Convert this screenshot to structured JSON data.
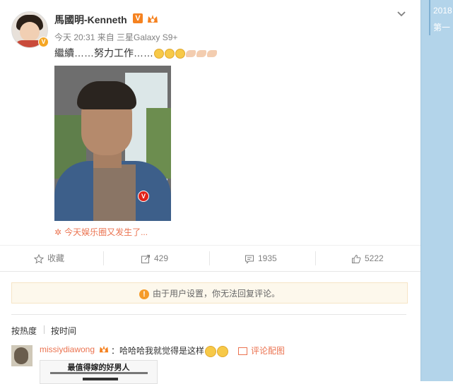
{
  "post": {
    "username": "馬國明-Kenneth",
    "verified_label": "V",
    "meta": "今天 20:31 来自 三星Galaxy S9+",
    "text": "繼續……努力工作……",
    "topic": "今天娱乐圈又发生了..."
  },
  "actions": {
    "favorite": "收藏",
    "repost_count": "429",
    "comment_count": "1935",
    "like_count": "5222"
  },
  "notice": "由于用户设置，你无法回复评论。",
  "sort": {
    "hot": "按热度",
    "time": "按时间"
  },
  "comment": {
    "user": "missiydiawong",
    "text": "：哈哈哈我就觉得是这样",
    "pic_link": "评论配图",
    "image_title": "最值得嫁的好男人"
  },
  "timeline": {
    "year": "2018",
    "sub": "第一"
  },
  "colors": {
    "accent": "#eb7350",
    "panel": "#b3d4ea",
    "notice_bg": "#fdf8ec"
  },
  "icons": [
    "chevron-down-icon",
    "star-icon",
    "repost-icon",
    "comment-icon",
    "like-icon",
    "warning-icon",
    "picture-icon"
  ]
}
